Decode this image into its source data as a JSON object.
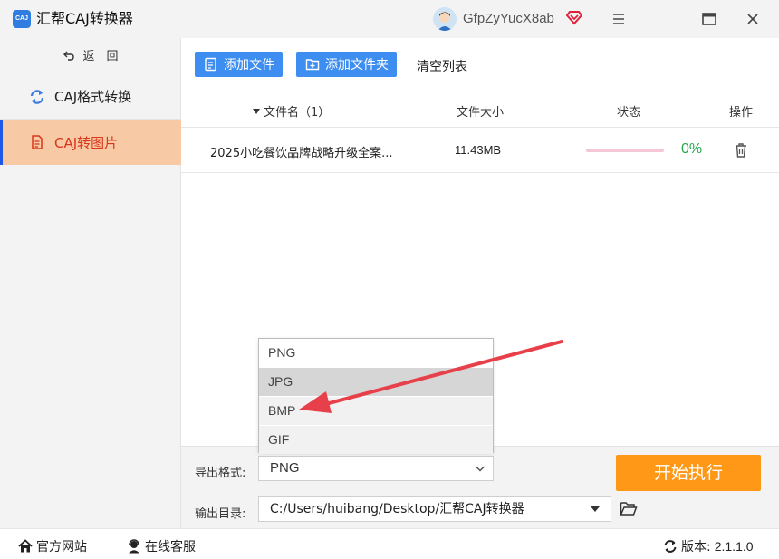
{
  "window": {
    "logo_text": "CAJ",
    "title": "汇帮CAJ转换器",
    "user_name": "GfpZyYucX8ab"
  },
  "sidebar": {
    "back_label": "返　回",
    "items": [
      {
        "label": "CAJ格式转换",
        "icon": "refresh-icon",
        "active": false
      },
      {
        "label": "CAJ转图片",
        "icon": "document-icon",
        "active": true
      }
    ]
  },
  "toolbar": {
    "add_file": "添加文件",
    "add_folder": "添加文件夹",
    "clear_list": "清空列表"
  },
  "table": {
    "columns": {
      "name": "文件名（1）",
      "size": "文件大小",
      "status": "状态",
      "ops": "操作"
    },
    "rows": [
      {
        "name": "2025小吃餐饮品牌战略升级全案...",
        "size": "11.43MB",
        "progress": 0,
        "percent": "0%"
      }
    ]
  },
  "settings": {
    "format_label": "导出格式:",
    "format_value": "PNG",
    "dir_label": "输出目录:",
    "dir_value": "C:/Users/huibang/Desktop/汇帮CAJ转换器",
    "start_button": "开始执行"
  },
  "dropdown": {
    "options": [
      "PNG",
      "JPG",
      "BMP",
      "GIF"
    ],
    "highlighted": "JPG"
  },
  "statusbar": {
    "website": "官方网站",
    "service": "在线客服",
    "version_label": "版本:",
    "version": "2.1.1.0"
  },
  "colors": {
    "accent_blue": "#3d8ef0",
    "start_orange": "#ff9717",
    "active_tab_bg": "#f7c9a4",
    "active_tab_text": "#d9361a",
    "success_green": "#22a84a",
    "annotation_red": "#e8404a"
  }
}
